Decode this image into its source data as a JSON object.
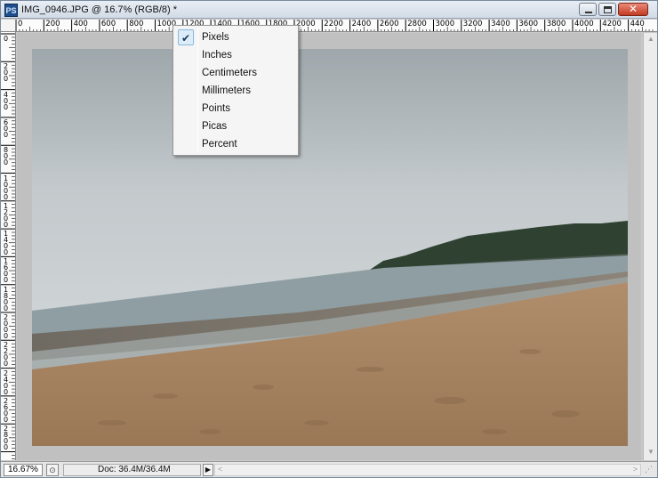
{
  "window": {
    "app_icon": "PS",
    "title": "IMG_0946.JPG @ 16.7% (RGB/8) *",
    "close_glyph": "✕"
  },
  "ruler": {
    "horizontal_labels": [
      "0",
      "200",
      "400",
      "600",
      "800",
      "1000",
      "1200",
      "1400",
      "1600",
      "1800",
      "2000",
      "2200",
      "2400",
      "2600",
      "2800",
      "3000",
      "3200",
      "3400",
      "3600",
      "3800",
      "4000",
      "4200",
      "440"
    ],
    "vertical_labels": [
      "0",
      "2",
      "0",
      "0",
      "4",
      "0",
      "0",
      "6",
      "0",
      "0",
      "8",
      "0",
      "0",
      "1",
      "0",
      "0",
      "0",
      "1",
      "2",
      "0",
      "0",
      "1",
      "4",
      "0",
      "0",
      "1",
      "6",
      "0",
      "0",
      "1",
      "8",
      "0",
      "0",
      "2",
      "0",
      "0",
      "0",
      "2",
      "2",
      "0",
      "0",
      "2",
      "4",
      "0",
      "0",
      "2",
      "6",
      "0",
      "0",
      "2",
      "8",
      "0",
      "0"
    ]
  },
  "units_menu": {
    "items": [
      {
        "label": "Pixels",
        "checked": true
      },
      {
        "label": "Inches",
        "checked": false
      },
      {
        "label": "Centimeters",
        "checked": false
      },
      {
        "label": "Millimeters",
        "checked": false
      },
      {
        "label": "Points",
        "checked": false
      },
      {
        "label": "Picas",
        "checked": false
      },
      {
        "label": "Percent",
        "checked": false
      }
    ]
  },
  "status": {
    "zoom": "16.67%",
    "doc_info": "Doc: 36.4M/36.4M",
    "arrow_glyph": "▶"
  },
  "colors": {
    "sky": "#c9cfd2",
    "sea": "#8a9ca0",
    "sand": "#a98563",
    "island": "#2f4232"
  }
}
